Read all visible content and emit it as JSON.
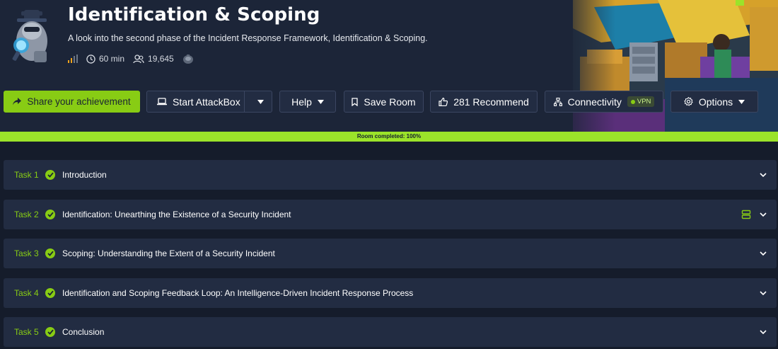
{
  "room": {
    "title": "Identification & Scoping",
    "subtitle": "A look into the second phase of the Incident Response Framework, Identification & Scoping.",
    "duration": "60 min",
    "users": "19,645",
    "difficulty_icon": "signal-bars-icon"
  },
  "actions": {
    "share": "Share your achievement",
    "attackbox": "Start AttackBox",
    "help": "Help",
    "save": "Save Room",
    "recommend": "281 Recommend",
    "connectivity": "Connectivity",
    "vpn": "VPN",
    "options": "Options"
  },
  "progress": {
    "label": "Room completed: 100%",
    "percent": 100
  },
  "tasks": [
    {
      "num": "Task 1",
      "title": "Introduction"
    },
    {
      "num": "Task 2",
      "title": "Identification: Unearthing the Existence of a Security Incident"
    },
    {
      "num": "Task 3",
      "title": "Scoping: Understanding the Extent of a Security Incident"
    },
    {
      "num": "Task 4",
      "title": "Identification and Scoping Feedback Loop: An Intelligence-Driven Incident Response Process"
    },
    {
      "num": "Task 5",
      "title": "Conclusion"
    }
  ],
  "colors": {
    "accent": "#88cc14",
    "background": "#151c2b",
    "panel": "#222c42"
  }
}
